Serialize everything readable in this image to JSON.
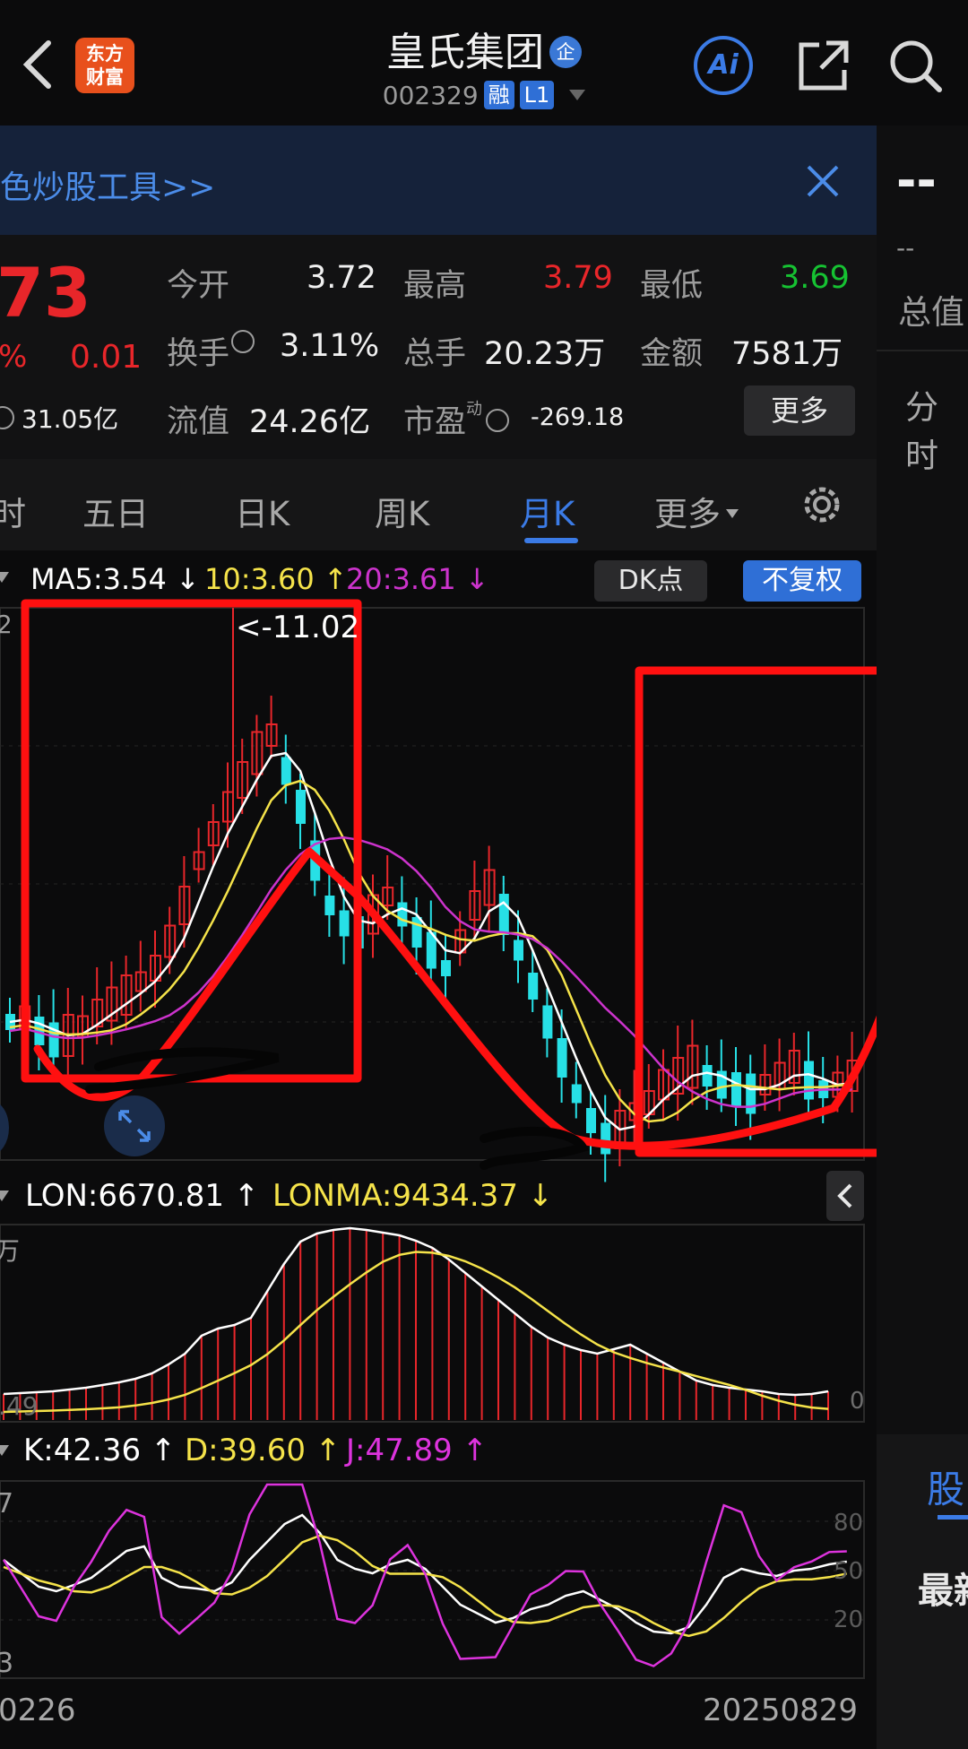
{
  "header": {
    "logo_line1": "东方",
    "logo_line2": "财富",
    "title": "皇氏集团",
    "title_badge": "企",
    "code": "002329",
    "tag_margin": "融",
    "tag_level": "L1",
    "ai_label": "Ai"
  },
  "banner": {
    "text": "色炒股工具>>"
  },
  "quote": {
    "price": "73",
    "change_pct": "%",
    "change": "0.01",
    "total_mv": "31.05亿",
    "open_label": "今开",
    "open": "3.72",
    "high_label": "最高",
    "high": "3.79",
    "low_label": "最低",
    "low": "3.69",
    "turnover_label": "换手",
    "turnover": "3.11%",
    "volume_label": "总手",
    "volume": "20.23万",
    "amount_label": "金额",
    "amount": "7581万",
    "float_label": "流值",
    "float": "24.26亿",
    "pe_label": "市盈",
    "pe_sup": "动",
    "pe": "-269.18",
    "more": "更多"
  },
  "tabs": {
    "t0": "时",
    "t1": "五日",
    "t2": "日K",
    "t3": "周K",
    "t4": "月K",
    "t5": "更多"
  },
  "ma": {
    "ma5": "MA5:3.54",
    "ma10": "10:3.60",
    "ma20": "20:3.61",
    "dk": "DK点",
    "fq": "不复权"
  },
  "chart": {
    "top_left_tick": "2",
    "annotation": "<-11.02"
  },
  "lon": {
    "lon": "LON:6670.81",
    "lonma": "LONMA:9434.37",
    "left_tick_top": "万",
    "left_tick_bottom": ".49",
    "right_tick": "0"
  },
  "kdj": {
    "k": "K:42.36",
    "d": "D:39.60",
    "j": "J:47.89",
    "left_top": "7",
    "left_bottom": "3",
    "r80": "80",
    "r50": "50",
    "r20": "20"
  },
  "dates": {
    "left": "0226",
    "right": "20250829"
  },
  "right_panel": {
    "dash": "--",
    "dash2": "--",
    "label_total": "总值",
    "label_fen": "分时",
    "label_gu": "股",
    "label_zui": "最新"
  },
  "colors": {
    "up": "#e8262a",
    "down": "#16c232",
    "accent": "#3b7be6",
    "ma5": "#ffffff",
    "ma10": "#f5e34a",
    "ma20": "#cc33cc"
  },
  "chart_data": {
    "type": "candlestick",
    "series": [
      {
        "name": "MA5",
        "values": [
          3.54
        ]
      },
      {
        "name": "MA10",
        "values": [
          3.6
        ]
      },
      {
        "name": "MA20",
        "values": [
          3.61
        ]
      }
    ],
    "max_label": "11.02"
  }
}
